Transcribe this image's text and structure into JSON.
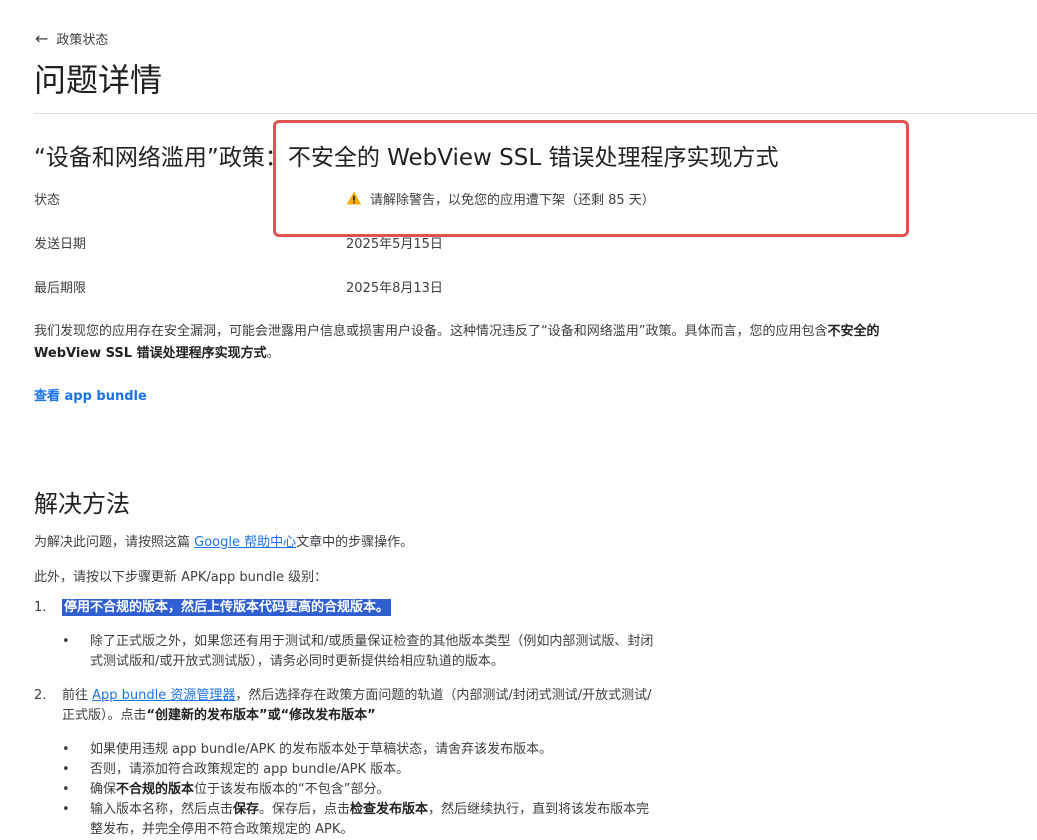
{
  "nav": {
    "back_label": "政策状态"
  },
  "page": {
    "title": "问题详情"
  },
  "issue": {
    "policy_title": "“设备和网络滥用”政策：不安全的 WebView SSL 错误处理程序实现方式",
    "rows": [
      {
        "label": "状态",
        "value": "请解除警告，以免您的应用遭下架（还剩 85 天）"
      },
      {
        "label": "发送日期",
        "value": "2025年5月15日"
      },
      {
        "label": "最后期限",
        "value": "2025年8月13日"
      }
    ],
    "description_part1": "我们发现您的应用存在安全漏洞，可能会泄露用户信息或损害用户设备。这种情况违反了“设备和网络滥用”政策。具体而言，您的应用包含",
    "description_bold": "不安全的 WebView SSL 错误处理程序实现方式",
    "description_part2": "。",
    "view_bundle_link": "查看 app bundle"
  },
  "resolution": {
    "title": "解决方法",
    "intro_before": "为解决此问题，请按照这篇 ",
    "intro_link": "Google 帮助中心",
    "intro_after": "文章中的步骤操作。",
    "also": "此外，请按以下步骤更新 APK/app bundle 级别：",
    "step1_num": "1.",
    "step1_text": "停用不合规的版本，然后上传版本代码更高的合规版本。",
    "step1_bullet": "除了正式版之外，如果您还有用于测试和/或质量保证检查的其他版本类型（例如内部测试版、封闭式测试版和/或开放式测试版），请务必同时更新提供给相应轨道的版本。",
    "step2_num": "2.",
    "step2_before": "前往 ",
    "step2_link": "App bundle 资源管理器",
    "step2_after": "，然后选择存在政策方面问题的轨道（内部测试/封闭式测试/开放式测试/正式版）。点击",
    "step2_bold": "“创建新的发布版本”或“修改发布版本”",
    "bullet_a": "如果使用违规 app bundle/APK 的发布版本处于草稿状态，请舍弃该发布版本。",
    "bullet_b": "否则，请添加符合政策规定的 app bundle/APK 版本。",
    "bullet_c_before": "确保",
    "bullet_c_bold": "不合规的版本",
    "bullet_c_after": "位于该发布版本的“不包含”部分。",
    "bullet_d_before": "输入版本名称，然后点击",
    "bullet_d_bold1": "保存",
    "bullet_d_mid": "。保存后，点击",
    "bullet_d_bold2": "检查发布版本",
    "bullet_d_after": "，然后继续执行，直到将该发布版本完整发布，并完全停用不符合政策规定的 APK。",
    "bullet_mark": "•"
  },
  "colors": {
    "link": "#1a73e8",
    "highlight": "#2f5fd0",
    "annotation": "#e05252",
    "warning": "#f9ab00"
  }
}
